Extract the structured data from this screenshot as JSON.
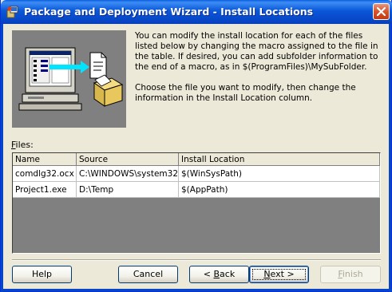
{
  "window": {
    "title": "Package and Deployment Wizard - Install Locations"
  },
  "description": {
    "paragraph1": "You can modify the install location for each of the files listed below by changing the macro assigned to the file in the table. If desired, you can add subfolder information to the end of a macro, as in $(ProgramFiles)\\MySubFolder.",
    "paragraph2": "Choose the file you want to modify, then change the information in the Install Location column."
  },
  "files": {
    "label_accel": "F",
    "label_rest": "iles:",
    "columns": [
      "Name",
      "Source",
      "Install Location"
    ],
    "rows": [
      [
        "comdlg32.ocx",
        "C:\\WINDOWS\\system32",
        "$(WinSysPath)"
      ],
      [
        "Project1.exe",
        "D:\\Temp",
        "$(AppPath)"
      ]
    ]
  },
  "buttons": {
    "help": "Help",
    "cancel": "Cancel",
    "back_prefix": "< ",
    "back_accel": "B",
    "back_rest": "ack",
    "next_accel": "N",
    "next_rest": "ext >",
    "finish_accel": "F",
    "finish_rest": "inish"
  },
  "icons": {
    "app": "setup-wizard-icon",
    "close": "close-icon",
    "illustration": "computer-with-files-illustration"
  },
  "colors": {
    "titlebar": "#0a57d8",
    "dialog_bg": "#ece9d8",
    "close_button": "#d9542a"
  }
}
